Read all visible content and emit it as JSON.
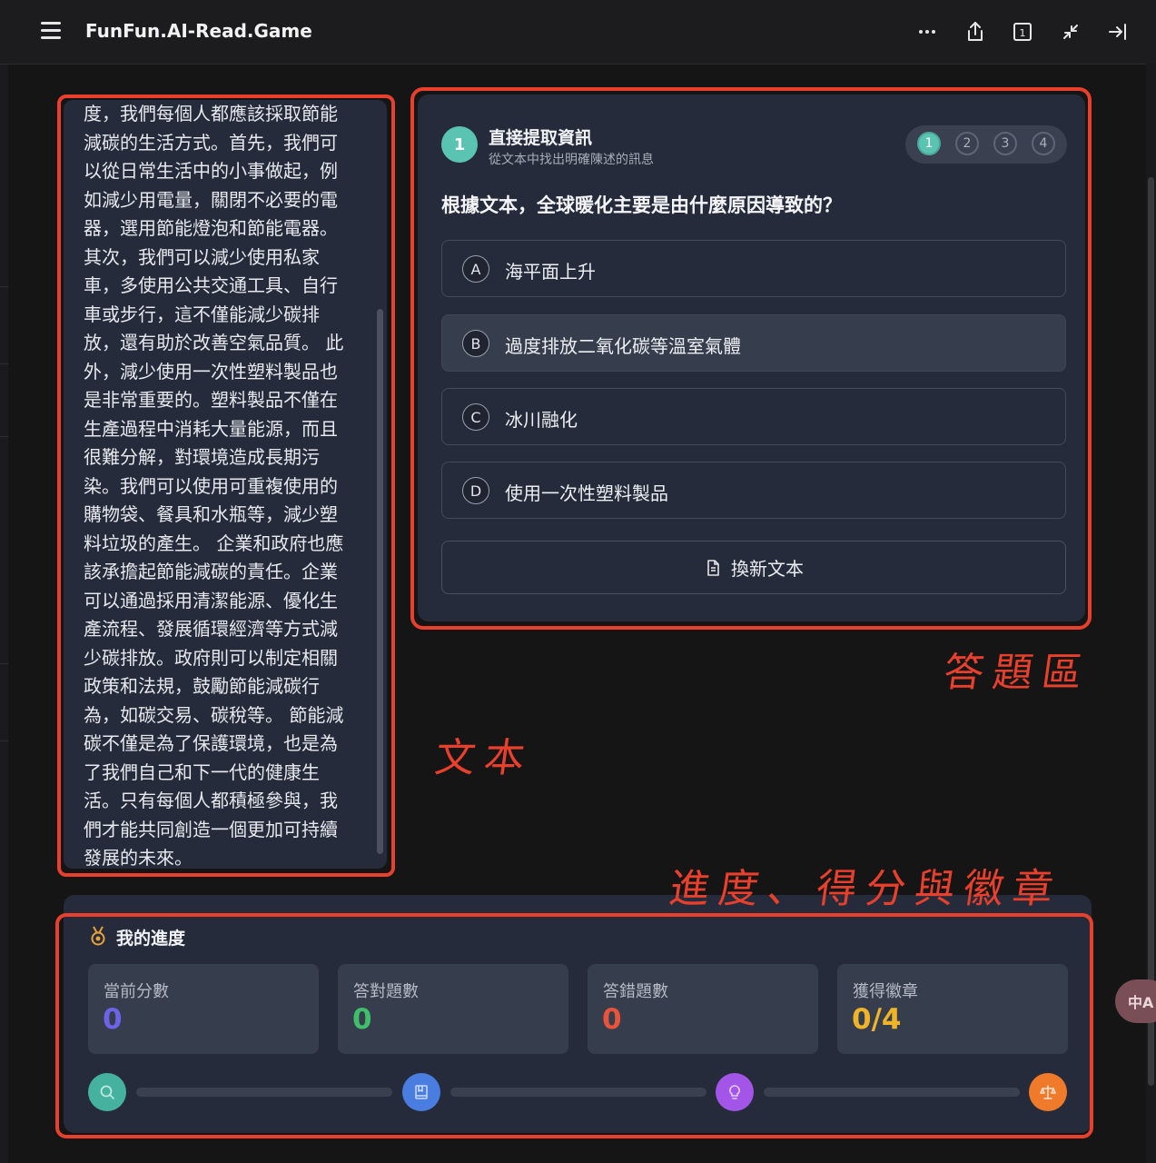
{
  "app": {
    "title": "FunFun.AI-Read.Game",
    "toolbar_icons": [
      "more-icon",
      "share-icon",
      "tab-count-icon",
      "collapse-icon",
      "sidebar-toggle-icon"
    ],
    "tab_count": "1"
  },
  "reading": {
    "text": "度，我們每個人都應該採取節能\n減碳的生活方式。首先，我們可\n以從日常生活中的小事做起，例\n如減少用電量，關閉不必要的電\n器，選用節能燈泡和節能電器。\n其次，我們可以減少使用私家\n車，多使用公共交通工具、自行\n車或步行，這不僅能減少碳排\n放，還有助於改善空氣品質。 此\n外，減少使用一次性塑料製品也\n是非常重要的。塑料製品不僅在\n生產過程中消耗大量能源，而且\n很難分解，對環境造成長期污\n染。我們可以使用可重複使用的\n購物袋、餐具和水瓶等，減少塑\n料垃圾的產生。 企業和政府也應\n該承擔起節能減碳的責任。企業\n可以通過採用清潔能源、優化生\n產流程、發展循環經濟等方式減\n少碳排放。政府則可以制定相關\n政策和法規，鼓勵節能減碳行\n為，如碳交易、碳稅等。 節能減\n碳不僅是為了保護環境，也是為\n了我們自己和下一代的健康生\n活。只有每個人都積極參與，我\n們才能共同創造一個更加可持續\n發展的未來。"
  },
  "quiz": {
    "number": "1",
    "type_title": "直接提取資訊",
    "type_desc": "從文本中找出明確陳述的訊息",
    "steps": [
      "1",
      "2",
      "3",
      "4"
    ],
    "active_step": 1,
    "question": "根據文本，全球暖化主要是由什麼原因導致的？",
    "options": [
      {
        "letter": "A",
        "text": "海平面上升"
      },
      {
        "letter": "B",
        "text": "過度排放二氧化碳等溫室氣體"
      },
      {
        "letter": "C",
        "text": "冰川融化"
      },
      {
        "letter": "D",
        "text": "使用一次性塑料製品"
      }
    ],
    "new_text_label": "換新文本"
  },
  "progress": {
    "title": "我的進度",
    "stats": [
      {
        "label": "當前分數",
        "value": "0",
        "color": "#6b63e8"
      },
      {
        "label": "答對題數",
        "value": "0",
        "color": "#3fbf6a"
      },
      {
        "label": "答錯題數",
        "value": "0",
        "color": "#e8543a"
      },
      {
        "label": "獲得徽章",
        "value": "0/4",
        "color": "#f0b429"
      }
    ],
    "badges": [
      {
        "icon": "search-icon",
        "color": "#44b29e"
      },
      {
        "icon": "book-icon",
        "color": "#4a7de0"
      },
      {
        "icon": "lightbulb-icon",
        "color": "#a255e6"
      },
      {
        "icon": "scale-icon",
        "color": "#ee7a2a"
      }
    ],
    "badges_earned": 0
  },
  "annotations": {
    "text_label": "文本",
    "quiz_label": "答題區",
    "progress_label": "進度、得分與徽章"
  },
  "translate_fab": "中A"
}
